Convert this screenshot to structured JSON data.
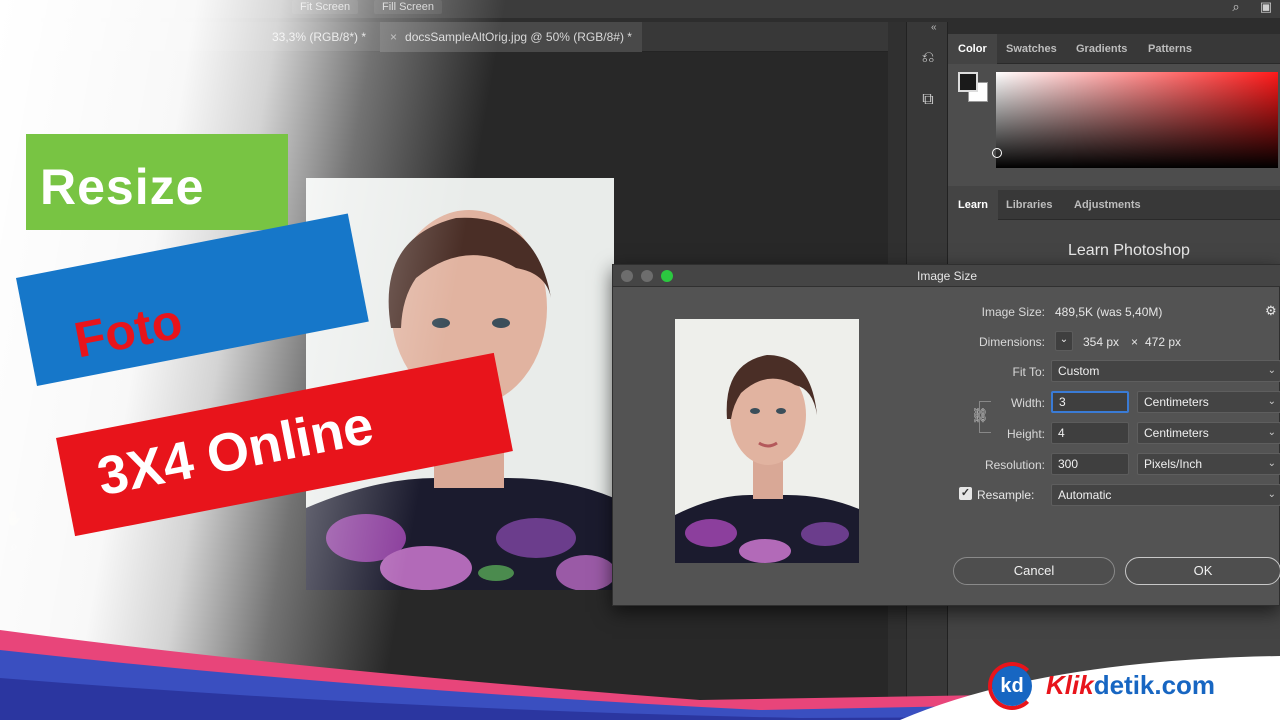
{
  "topbar": {
    "btn_fit": "Fit Screen",
    "btn_fill": "Fill Screen"
  },
  "doc_tabs": {
    "tab1": "33,3% (RGB/8*) *",
    "tab2_close": "×",
    "tab2": "docsSampleAltOrig.jpg @ 50% (RGB/8#) *"
  },
  "panels": {
    "color_tabs": [
      "Color",
      "Swatches",
      "Gradients",
      "Patterns"
    ],
    "learn_tabs": [
      "Learn",
      "Libraries",
      "Adjustments"
    ],
    "learn_title": "Learn Photoshop",
    "ramp_colors": {
      "hue": "#ff1a1a"
    }
  },
  "dialog": {
    "title": "Image Size",
    "image_size_label": "Image Size:",
    "image_size_value": "489,5K (was 5,40M)",
    "dimensions_label": "Dimensions:",
    "dim_w": "354 px",
    "dim_x": "×",
    "dim_h": "472 px",
    "fit_to_label": "Fit To:",
    "fit_to_value": "Custom",
    "width_label": "Width:",
    "width_value": "3",
    "width_unit": "Centimeters",
    "height_label": "Height:",
    "height_value": "4",
    "height_unit": "Centimeters",
    "resolution_label": "Resolution:",
    "resolution_value": "300",
    "resolution_unit": "Pixels/Inch",
    "resample_label": "Resample:",
    "resample_value": "Automatic",
    "cancel": "Cancel",
    "ok": "OK"
  },
  "banner": {
    "line1": "Resize",
    "line2": "Foto",
    "line3": "3X4 Online",
    "colors": {
      "green": "#78c443",
      "blue": "#1677c9",
      "red": "#e8141b"
    }
  },
  "brand": {
    "logo": "kd",
    "name_a": "Klik",
    "name_b": "detik.com"
  }
}
